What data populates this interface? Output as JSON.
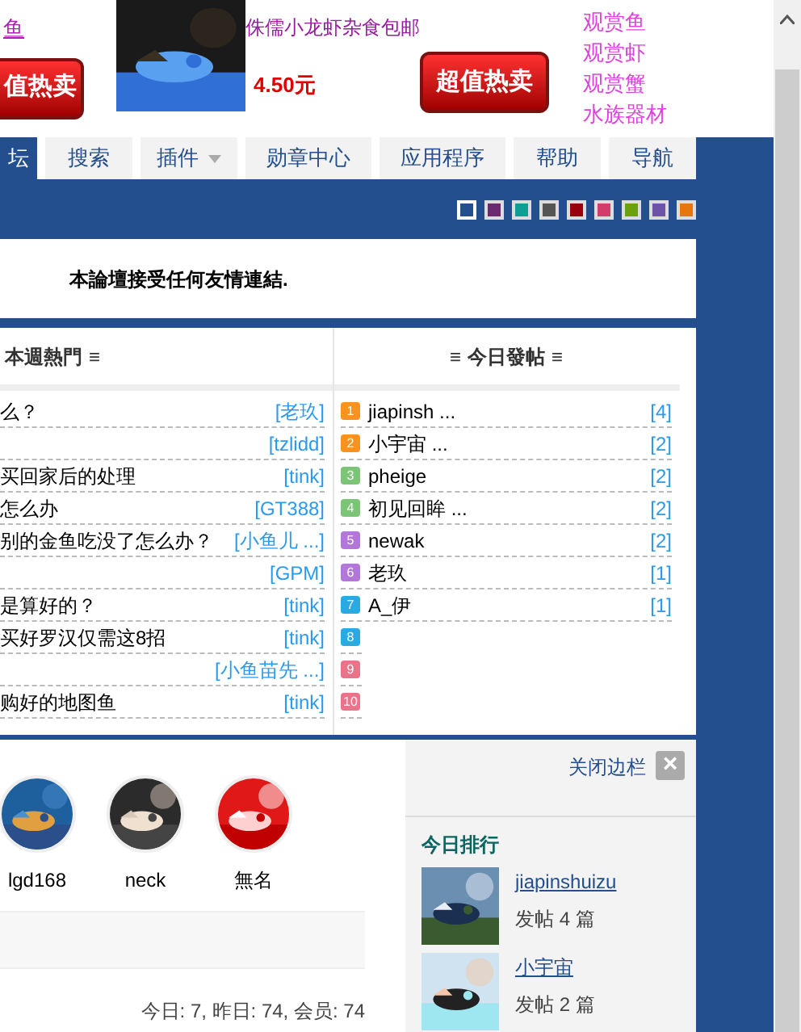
{
  "ad": {
    "left_link": "鱼",
    "left_button": "值热卖",
    "product_title": "侏儒小龙虾杂食包邮",
    "price": "4.50元",
    "button": "超值热卖",
    "links": [
      "观赏鱼",
      "观赏虾",
      "观赏蟹",
      "水族器材"
    ]
  },
  "nav": [
    {
      "label": "坛",
      "selected": true
    },
    {
      "label": "搜索",
      "selected": false
    },
    {
      "label": "插件",
      "selected": false,
      "dropdown": true
    },
    {
      "label": "勋章中心",
      "selected": false
    },
    {
      "label": "应用程序",
      "selected": false
    },
    {
      "label": "帮助",
      "selected": false
    },
    {
      "label": "导航",
      "selected": false
    }
  ],
  "theme_swatches": [
    {
      "color": "#244f8e",
      "selected": true
    },
    {
      "color": "#6b2a6f",
      "selected": false
    },
    {
      "color": "#0e9e93",
      "selected": false
    },
    {
      "color": "#555555",
      "selected": false
    },
    {
      "color": "#99000b",
      "selected": false
    },
    {
      "color": "#d23c6a",
      "selected": false
    },
    {
      "color": "#6ca00d",
      "selected": false
    },
    {
      "color": "#6d54a8",
      "selected": false
    },
    {
      "color": "#e6770c",
      "selected": false
    }
  ],
  "notice": "本論壇接受任何友情連結.",
  "hot_week": {
    "title": "本週熱門",
    "menu_icon": "≡",
    "rows": [
      {
        "title": "么？",
        "author": "[老玖]"
      },
      {
        "author": "[tzlidd]"
      },
      {
        "title": "买回家后的处理",
        "author": "[tink]"
      },
      {
        "title": "怎么办",
        "author": "[GT388]"
      },
      {
        "title": "别的金鱼吃没了怎么办？",
        "author": "[小鱼儿 ...]"
      },
      {
        "author": "[GPM]"
      },
      {
        "title": "是算好的？",
        "author": "[tink]"
      },
      {
        "title": "买好罗汉仅需这8招",
        "author": "[tink]"
      },
      {
        "author": "[小鱼苗先 ...]"
      },
      {
        "title": "购好的地图鱼",
        "author": "[tink]"
      }
    ]
  },
  "today_posts": {
    "title": "今日發帖",
    "menu_icon_left": "≡",
    "menu_icon_right": "≡",
    "rows": [
      {
        "rank": "1",
        "color": "#f7931e",
        "name": "jiapinsh ...",
        "count": "[4]"
      },
      {
        "rank": "2",
        "color": "#f7931e",
        "name": "小宇宙 ...",
        "count": "[2]"
      },
      {
        "rank": "3",
        "color": "#7cc576",
        "name": "pheige",
        "count": "[2]"
      },
      {
        "rank": "4",
        "color": "#7cc576",
        "name": "初见回眸 ...",
        "count": "[2]"
      },
      {
        "rank": "5",
        "color": "#b377d9",
        "name": "newak",
        "count": "[2]"
      },
      {
        "rank": "6",
        "color": "#b377d9",
        "name": "老玖",
        "count": "[1]"
      },
      {
        "rank": "7",
        "color": "#29abe2",
        "name": "A_伊",
        "count": "[1]"
      },
      {
        "rank": "8",
        "color": "#29abe2"
      },
      {
        "rank": "9",
        "color": "#e9748a"
      },
      {
        "rank": "10",
        "color": "#e9748a"
      }
    ]
  },
  "members": [
    {
      "name": "lgd168"
    },
    {
      "name": "neck"
    },
    {
      "name": "無名"
    }
  ],
  "stats": "今日: 7, 昨日: 74, 会员: 74",
  "sidebar": {
    "close_label": "关闭边栏",
    "close_icon": "×",
    "ranking_title": "今日排行",
    "users": [
      {
        "name": "jiapinshuizu",
        "posts": "发帖 4 篇"
      },
      {
        "name": "小宇宙",
        "posts": "发帖 2 篇"
      }
    ]
  }
}
